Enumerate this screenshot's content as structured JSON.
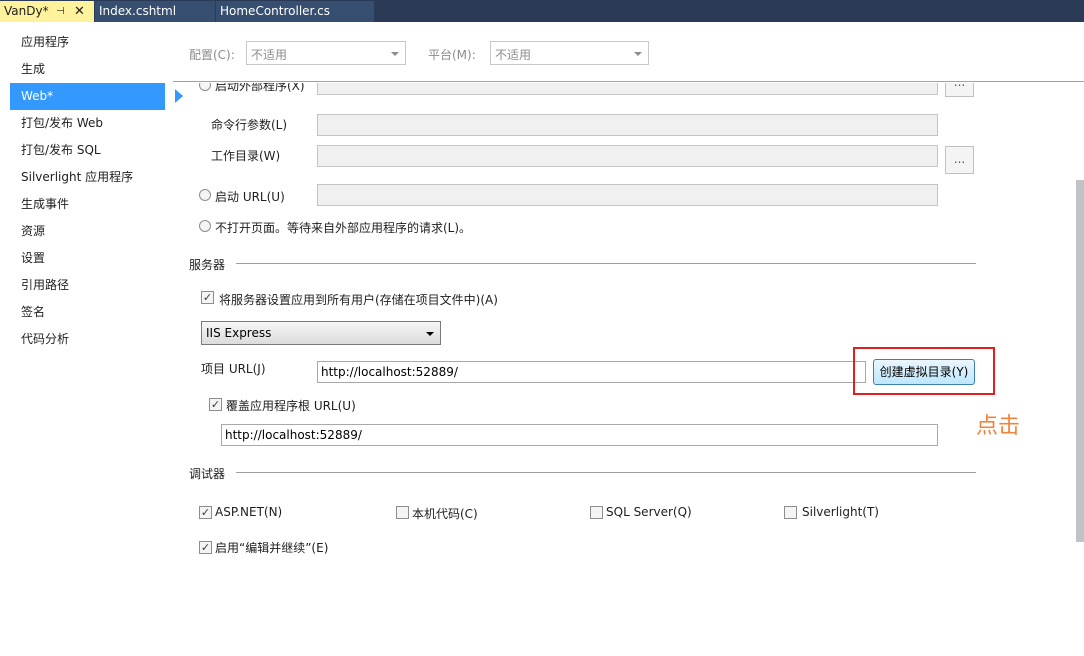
{
  "tabs": [
    {
      "label": "VanDy*",
      "pin": "⊣",
      "close": "✕"
    },
    {
      "label": "Index.cshtml"
    },
    {
      "label": "HomeController.cs"
    }
  ],
  "sidebar": {
    "items": [
      {
        "label": "应用程序"
      },
      {
        "label": "生成"
      },
      {
        "label": "Web*"
      },
      {
        "label": "打包/发布 Web"
      },
      {
        "label": "打包/发布 SQL"
      },
      {
        "label": "Silverlight 应用程序"
      },
      {
        "label": "生成事件"
      },
      {
        "label": "资源"
      },
      {
        "label": "设置"
      },
      {
        "label": "引用路径"
      },
      {
        "label": "签名"
      },
      {
        "label": "代码分析"
      }
    ],
    "selected_index": 2
  },
  "config": {
    "config_label": "配置(C):",
    "config_value": "不适用",
    "platform_label": "平台(M):",
    "platform_value": "不适用"
  },
  "start_action": {
    "external_program_label": "启动外部程序(X)",
    "external_browse": "...",
    "cmd_args_label": "命令行参数(L)",
    "workdir_label": "工作目录(W)",
    "workdir_browse": "...",
    "start_url_label": "启动 URL(U)",
    "no_open_label": "不打开页面。等待来自外部应用程序的请求(L)。"
  },
  "servers": {
    "title": "服务器",
    "apply_all_label": "将服务器设置应用到所有用户(存储在项目文件中)(A)",
    "apply_all_checked": true,
    "server_type": "IIS Express",
    "project_url_label": "项目 URL(J)",
    "project_url_value": "http://localhost:52889/",
    "create_vdir_button": "创建虚拟目录(Y)",
    "override_root_label": "覆盖应用程序根 URL(U)",
    "override_root_checked": true,
    "override_root_value": "http://localhost:52889/"
  },
  "annotation": "点击",
  "debuggers": {
    "title": "调试器",
    "aspnet_label": "ASP.NET(N)",
    "aspnet_checked": true,
    "native_label": "本机代码(C)",
    "native_checked": false,
    "sql_label": "SQL Server(Q)",
    "sql_checked": false,
    "silverlight_label": "Silverlight(T)",
    "silverlight_checked": false,
    "edit_continue_label": "启用“编辑并继续”(E)",
    "edit_continue_checked": true
  }
}
